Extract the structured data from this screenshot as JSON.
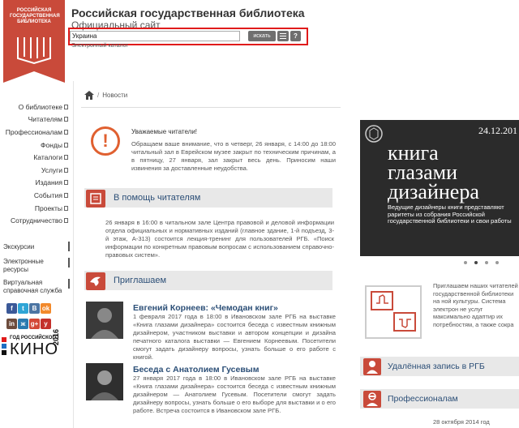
{
  "header": {
    "logo_text": "РОССИЙСКАЯ ГОСУДАРСТВЕННАЯ БИБЛИОТЕКА",
    "site_title": "Российская государственная библиотека",
    "site_subtitle": "Официальный сайт",
    "search_value": "Украина",
    "search_button": "искать",
    "help_button": "?",
    "catalog_label": "Электронный каталог"
  },
  "sidebar": {
    "items": [
      {
        "label": "О библиотеке"
      },
      {
        "label": "Читателям"
      },
      {
        "label": "Профессионалам"
      },
      {
        "label": "Фонды"
      },
      {
        "label": "Каталоги"
      },
      {
        "label": "Услуги"
      },
      {
        "label": "Издания"
      },
      {
        "label": "События"
      },
      {
        "label": "Проекты"
      },
      {
        "label": "Сотрудничество"
      }
    ],
    "extra": [
      "Экскурсии",
      "Электронные ресурсы",
      "Виртуальная справочная служба"
    ],
    "social_labels": [
      "f",
      "t",
      "В",
      "ok",
      "in",
      "ж",
      "g+",
      "y"
    ],
    "kino_year_label": "ГОД РОССИЙСКОГО",
    "kino_word": "КИНО",
    "kino_year": "2016"
  },
  "breadcrumb": {
    "current": "Новости"
  },
  "alert": {
    "title": "Уважаемые читатели!",
    "text": "Обращаем ваше внимание, что в четверг, 26 января, с 14:00 до 18:00 читальный зал в Еврейском музее закрыт по техническим причинам, а в пятницу, 27 января, зал закрыт весь день. Приносим наши извинения за доставленные неудобства."
  },
  "help_section": {
    "title": "В помощь читателям",
    "text": "26 января в 16:00 в читальном зале Центра правовой и деловой информации отдела официальных и нормативных изданий (главное здание, 1-й подъезд, 3-й этаж, А-313) состоится лекция-тренинг для пользователей РГБ. «Поиск информации по конкретным правовым вопросам с использованием справочно-правовых систем»."
  },
  "invite_section": {
    "title": "Приглашаем",
    "events": [
      {
        "title": "Евгений Корнеев: «Чемодан книг»",
        "text": "1 февраля 2017 года в 18:00 в Ивановском зале РГБ на выставке «Книга глазами дизайнера» состоится беседа с известным книжным дизайнером, участником выставки и автором концепции и дизайна печатного каталога выставки — Евгением Корнеевым. Посетители смогут задать дизайнеру вопросы, узнать больше о его работе с книгой."
      },
      {
        "title": "Беседа с Анатолием Гусевым",
        "text": "27 января 2017 года в 18:00 в Ивановском зале РГБ на выставке «Книга глазами дизайнера» состоится беседа с известным книжным дизайнером — Анатолием Гусевым. Посетители смогут задать дизайнеру вопросы, узнать больше о его выборе для выставки и о его работе. Встреча состоится в Ивановском зале РГБ."
      }
    ]
  },
  "banner": {
    "date": "24.12.201",
    "lines": [
      "книга",
      "глазами",
      "дизайнера"
    ],
    "description": "Ведущие дизайнеры книги представляют раритеты из собрания Российской государственной библиотеки и свои работы",
    "slide_count": 4,
    "active_slide": 2
  },
  "right_info": {
    "text": "Приглашаем наших читателей государственной библиотеки на ной культуры. Система электрон не услуг максимально адаптир их потребностям, а также сокра"
  },
  "right_links": [
    "Удалённая запись в РГБ",
    "Профессионалам"
  ],
  "bottom_date": "28 октября 2014 год",
  "colors": {
    "brand": "#c94a3a",
    "link": "#2c4f77",
    "highlight": "#e01b1b"
  }
}
